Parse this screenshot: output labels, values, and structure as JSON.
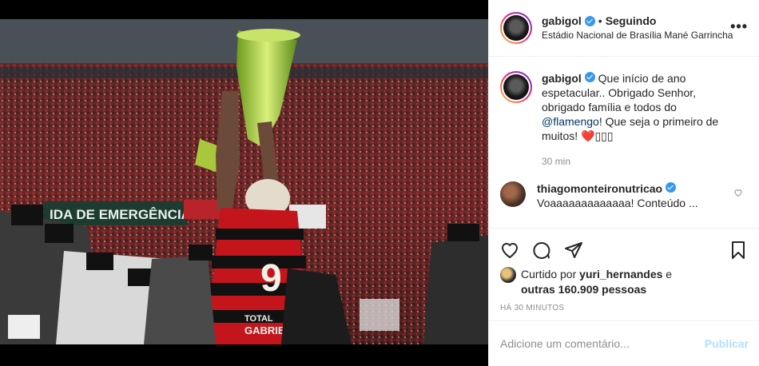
{
  "post": {
    "username": "gabigol",
    "follow_status": "Seguindo",
    "separator": "•",
    "location": "Estádio Nacional de Brasília Mané Garrincha",
    "more_icon": "more-options-icon"
  },
  "caption": {
    "username": "gabigol",
    "text_before": " Que início de ano espetacular.. Obrigado Senhor, obrigado família e todos do ",
    "mention": "@flamengo",
    "text_after": "! Que seja o primeiro de muitos! ❤️▯▯▯",
    "time": "30 min"
  },
  "comments": [
    {
      "username": "thiagomonteironutricao",
      "text": "Voaaaaaaaaaaaaa! Conteúdo ..."
    }
  ],
  "photo": {
    "banner_text": "IDA DE EMERGÊNCIA",
    "jersey_number": "9",
    "jersey_name": "GABRIEL",
    "sponsor": "TOTAL",
    "colors": {
      "jersey_red": "#c4151c",
      "jersey_black": "#111111",
      "trophy": "#8fbf2a"
    }
  },
  "likes": {
    "prefix": "Curtido por ",
    "user": "yuri_hernandes",
    "conj": " e",
    "others": "outras 160.909 pessoas"
  },
  "timestamp": "HÁ 30 MINUTOS",
  "add_comment": {
    "placeholder": "Adicione um comentário...",
    "publish_label": "Publicar"
  },
  "colors": {
    "verified": "#3897f0",
    "mention": "#00376b",
    "publish": "#b2dffc"
  }
}
